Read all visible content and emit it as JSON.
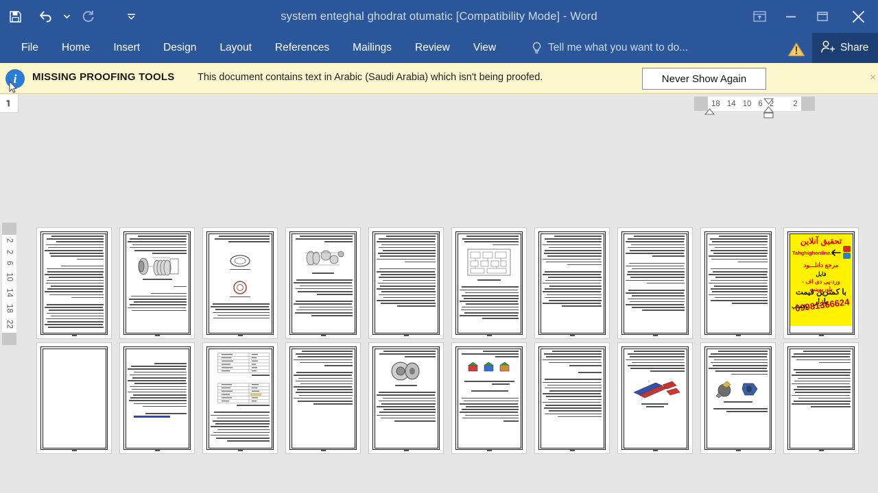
{
  "window": {
    "title": "system enteghal ghodrat otumatic [Compatibility Mode] - Word",
    "accent_color": "#2b579a",
    "share_accent": "#1e3f73"
  },
  "quick_access": {
    "items": [
      {
        "name": "save-icon",
        "label": "Save"
      },
      {
        "name": "undo-icon",
        "label": "Undo"
      },
      {
        "name": "undo-dropdown-icon",
        "label": "Undo options"
      },
      {
        "name": "redo-icon",
        "label": "Redo"
      },
      {
        "name": "customize-qat-icon",
        "label": "Customize Quick Access Toolbar"
      }
    ]
  },
  "window_controls": [
    {
      "name": "ribbon-display-options-icon",
      "label": "Ribbon Display Options"
    },
    {
      "name": "minimize-icon",
      "label": "Minimize"
    },
    {
      "name": "restore-icon",
      "label": "Restore Down"
    },
    {
      "name": "close-icon",
      "label": "Close"
    }
  ],
  "ribbon": {
    "tabs": [
      {
        "label": "File"
      },
      {
        "label": "Home"
      },
      {
        "label": "Insert"
      },
      {
        "label": "Design"
      },
      {
        "label": "Layout"
      },
      {
        "label": "References"
      },
      {
        "label": "Mailings"
      },
      {
        "label": "Review"
      },
      {
        "label": "View"
      }
    ],
    "tell_me": "Tell me what you want to do...",
    "share_label": "Share",
    "warning_icon": "warning-triangle-icon"
  },
  "message_bar": {
    "icon": "info-icon",
    "title": "MISSING PROOFING TOOLS",
    "text": "This document contains text in Arabic (Saudi Arabia) which isn't being proofed.",
    "button_label": "Never Show Again",
    "close_label": "×",
    "background": "#fdf7cd"
  },
  "rulers": {
    "horizontal_ticks": [
      "18",
      "14",
      "10",
      "6",
      "2",
      "2"
    ],
    "vertical_ticks": [
      "2",
      "2",
      "6",
      "10",
      "14",
      "18",
      "22"
    ],
    "corner_icon": "tab-stop-icon"
  },
  "document": {
    "view": "Multiple Pages",
    "rows": [
      {
        "pages": [
          {
            "kind": "text",
            "lines": [
              9,
              12,
              9
            ],
            "figure": null
          },
          {
            "kind": "text",
            "lines": [
              7
            ],
            "figure": "clutch-plates-diagram",
            "lines_after": [
              1,
              5
            ]
          },
          {
            "kind": "text",
            "lines": [
              4
            ],
            "figure": "gear-ring-diagram",
            "lines_after": [
              12
            ]
          },
          {
            "kind": "text",
            "lines": [
              3
            ],
            "figure": "gearbox-assembly-diagram",
            "lines_after": [
              6,
              7
            ]
          },
          {
            "kind": "text",
            "lines": [
              10,
              14
            ],
            "figure": null
          },
          {
            "kind": "text",
            "lines": [
              4
            ],
            "figure": "hydraulic-circuit-diagram",
            "lines_after": [
              13
            ]
          },
          {
            "kind": "text",
            "lines": [
              11,
              13
            ],
            "figure": null
          },
          {
            "kind": "text",
            "lines": [
              8,
              8,
              8
            ],
            "figure": null
          },
          {
            "kind": "text",
            "lines": [
              10,
              13
            ],
            "figure": null
          },
          {
            "kind": "ad",
            "title": "تحقیق آنلاین",
            "site": "Tahghighonline.ir",
            "line3": "مرجع دانلـــود",
            "line4": "فایل",
            "line5": "ورد-پی دی اف - پاورپوینت",
            "line6": "با کمترین قیمت بازار",
            "phone": "09981366624",
            "phone_label": "واتساپ"
          }
        ]
      },
      {
        "pages": [
          {
            "kind": "blank"
          },
          {
            "kind": "text",
            "lines": [
              16
            ],
            "figure": null,
            "underline": true
          },
          {
            "kind": "table",
            "figure": "two-data-tables",
            "lines_after": [
              12
            ]
          },
          {
            "kind": "text",
            "lines": [
              6,
              12
            ],
            "figure": null
          },
          {
            "kind": "text",
            "lines": [
              3
            ],
            "figure": "torque-converter-diagram",
            "lines_after": [
              11
            ]
          },
          {
            "kind": "text",
            "lines": [
              3
            ],
            "figure": "three-gear-icons",
            "lines_after": [
              3,
              9
            ]
          },
          {
            "kind": "text",
            "lines": [
              6,
              14
            ],
            "figure": null
          },
          {
            "kind": "text",
            "lines": [
              8
            ],
            "figure": "red-blue-shaft-diagram",
            "lines_after": [
              3
            ]
          },
          {
            "kind": "text",
            "lines": [
              9
            ],
            "figure": "pump-parts-diagram",
            "lines_after": [
              3
            ]
          },
          {
            "kind": "text",
            "lines": [
              5,
              13
            ],
            "figure": null
          }
        ]
      }
    ]
  }
}
